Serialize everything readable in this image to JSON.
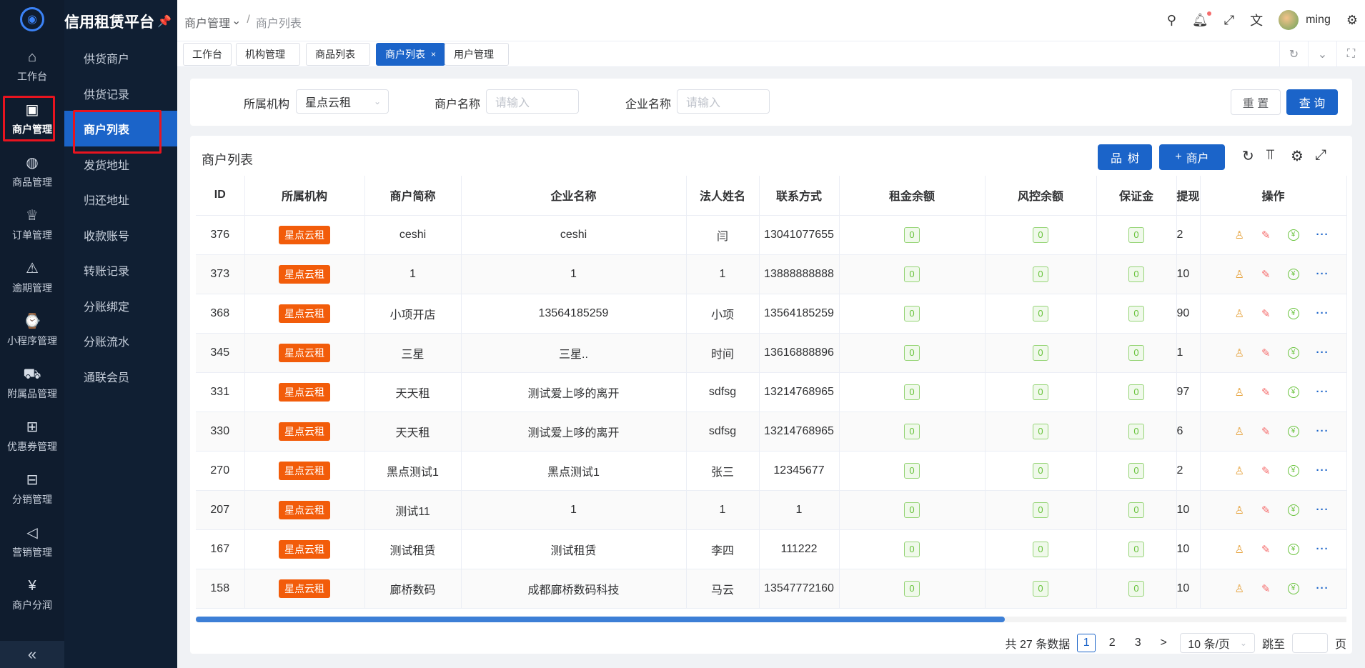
{
  "rail": {
    "items": [
      {
        "label": "工作台",
        "icon": "home-icon",
        "glyph": "⌂"
      },
      {
        "label": "商户管理",
        "icon": "shopping-bag-icon",
        "glyph": "▣"
      },
      {
        "label": "商品管理",
        "icon": "apple-icon",
        "glyph": "◍"
      },
      {
        "label": "订单管理",
        "icon": "trophy-icon",
        "glyph": "♕"
      },
      {
        "label": "逾期管理",
        "icon": "alarm-icon",
        "glyph": "⚠"
      },
      {
        "label": "小程序管理",
        "icon": "watch-icon",
        "glyph": "⌚"
      },
      {
        "label": "附属品管理",
        "icon": "cart-icon",
        "glyph": "⛟"
      },
      {
        "label": "优惠券管理",
        "icon": "gift-icon",
        "glyph": "⊞"
      },
      {
        "label": "分销管理",
        "icon": "sliders-icon",
        "glyph": "⊟"
      },
      {
        "label": "营销管理",
        "icon": "megaphone-icon",
        "glyph": "◁"
      },
      {
        "label": "商户分润",
        "icon": "yen-circle-icon",
        "glyph": "¥"
      }
    ],
    "collapse_glyph": "«"
  },
  "submenu": {
    "brand": "信用租赁平台",
    "items": [
      "供货商户",
      "供货记录",
      "商户列表",
      "发货地址",
      "归还地址",
      "收款账号",
      "转账记录",
      "分账绑定",
      "分账流水",
      "通联会员"
    ]
  },
  "header": {
    "crumb_parent": "商户管理",
    "crumb_current": "商户列表",
    "username": "ming"
  },
  "tabs": [
    "工作台",
    "机构管理",
    "商品列表",
    "商户列表",
    "用户管理"
  ],
  "search": {
    "org_label": "所属机构",
    "org_value": "星点云租",
    "merchant_label": "商户名称",
    "merchant_placeholder": "请输入",
    "company_label": "企业名称",
    "company_placeholder": "请输入",
    "reset": "重 置",
    "query": "查 询"
  },
  "table": {
    "title": "商户列表",
    "tree_btn": "树",
    "add_btn": "商户",
    "columns": [
      "ID",
      "所属机构",
      "商户简称",
      "企业名称",
      "法人姓名",
      "联系方式",
      "租金余额",
      "风控余额",
      "保证金",
      "提现",
      "操作"
    ],
    "rows": [
      {
        "id": "376",
        "org": "星点云租",
        "short": "ceshi",
        "company": "ceshi",
        "legal": "闫",
        "phone": "13041077655",
        "rent": "0",
        "risk": "0",
        "deposit": "0",
        "withdraw": "2"
      },
      {
        "id": "373",
        "org": "星点云租",
        "short": "1",
        "company": "1",
        "legal": "1",
        "phone": "13888888888",
        "rent": "0",
        "risk": "0",
        "deposit": "0",
        "withdraw": "10"
      },
      {
        "id": "368",
        "org": "星点云租",
        "short": "小项开店",
        "company": "13564185259",
        "legal": "小项",
        "phone": "13564185259",
        "rent": "0",
        "risk": "0",
        "deposit": "0",
        "withdraw": "90"
      },
      {
        "id": "345",
        "org": "星点云租",
        "short": "三星",
        "company": "三星..",
        "legal": "时间",
        "phone": "13616888896",
        "rent": "0",
        "risk": "0",
        "deposit": "0",
        "withdraw": "1"
      },
      {
        "id": "331",
        "org": "星点云租",
        "short": "天天租",
        "company": "测试爱上哆的离开",
        "legal": "sdfsg",
        "phone": "13214768965",
        "rent": "0",
        "risk": "0",
        "deposit": "0",
        "withdraw": "97"
      },
      {
        "id": "330",
        "org": "星点云租",
        "short": "天天租",
        "company": "测试爱上哆的离开",
        "legal": "sdfsg",
        "phone": "13214768965",
        "rent": "0",
        "risk": "0",
        "deposit": "0",
        "withdraw": "6"
      },
      {
        "id": "270",
        "org": "星点云租",
        "short": "黑点测试1",
        "company": "黑点测试1",
        "legal": "张三",
        "phone": "12345677",
        "rent": "0",
        "risk": "0",
        "deposit": "0",
        "withdraw": "2"
      },
      {
        "id": "207",
        "org": "星点云租",
        "short": "测试11",
        "company": "1",
        "legal": "1",
        "phone": "1",
        "rent": "0",
        "risk": "0",
        "deposit": "0",
        "withdraw": "10"
      },
      {
        "id": "167",
        "org": "星点云租",
        "short": "测试租赁",
        "company": "测试租赁",
        "legal": "李四",
        "phone": "111222",
        "rent": "0",
        "risk": "0",
        "deposit": "0",
        "withdraw": "10"
      },
      {
        "id": "158",
        "org": "星点云租",
        "short": "廊桥数码",
        "company": "成都廊桥数码科技",
        "legal": "马云",
        "phone": "13547772160",
        "rent": "0",
        "risk": "0",
        "deposit": "0",
        "withdraw": "10"
      }
    ]
  },
  "pager": {
    "total": "共 27 条数据",
    "pages": [
      "1",
      "2",
      "3"
    ],
    "next": ">",
    "size": "10 条/页",
    "jump_label": "跳至",
    "page_suffix": "页"
  },
  "colors": {
    "primary": "#1b64c9",
    "org_tag": "#f25c0a",
    "highlight_box": "#e8141f",
    "sidebar": "#0f1c2e"
  }
}
